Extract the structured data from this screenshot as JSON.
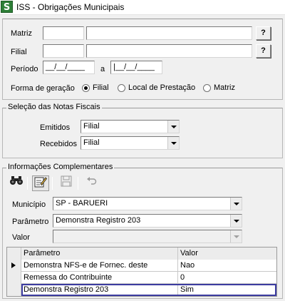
{
  "window": {
    "title": "ISS - Obrigações Municipais",
    "icon": "S"
  },
  "filters": {
    "matriz_label": "Matriz",
    "filial_label": "Filial",
    "periodo_label": "Período",
    "periodo_from": "__/__/____",
    "periodo_sep": "a",
    "periodo_to": "|__/__/____",
    "lookup_button": "?",
    "forma_label": "Forma de geração",
    "forma_options": [
      "Filial",
      "Local de Prestação",
      "Matriz"
    ],
    "forma_selected": "Filial"
  },
  "notas": {
    "group_label": "Seleção das Notas Fiscais",
    "emitidos_label": "Emitidos",
    "emitidos_value": "Filial",
    "recebidos_label": "Recebidos",
    "recebidos_value": "Filial"
  },
  "info": {
    "group_label": "Informações Complementares",
    "toolbar_icons": [
      "binoculars-icon",
      "edit-icon",
      "save-icon",
      "undo-icon"
    ],
    "municipio_label": "Município",
    "municipio_value": "SP - BARUERI",
    "parametro_label": "Parâmetro",
    "parametro_value": "Demonstra Registro 203",
    "valor_label": "Valor",
    "valor_value": ""
  },
  "grid": {
    "columns": [
      "Parâmetro",
      "Valor"
    ],
    "rows": [
      {
        "parametro": "Demonstra NFS-e de Fornec. deste",
        "valor": "Nao"
      },
      {
        "parametro": "Remessa do Contribuinte",
        "valor": "0"
      },
      {
        "parametro": "Demonstra Registro 203",
        "valor": "Sim"
      }
    ]
  },
  "colors": {
    "selected_row_border": "#3c3ca0",
    "app_icon": "#2d7f37"
  }
}
